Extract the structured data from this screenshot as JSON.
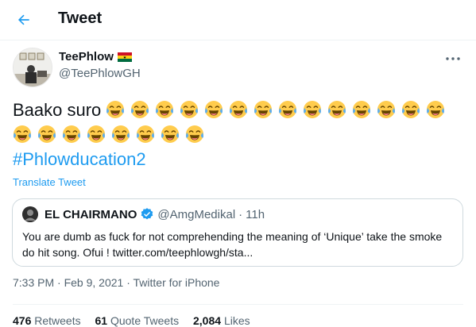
{
  "header": {
    "title": "Tweet",
    "back_icon": "arrow-left-icon",
    "accent": "#1d9bf0"
  },
  "author": {
    "name": "TeePhlow",
    "flag": "Ghana flag",
    "handle": "@TeePhlowGH"
  },
  "tweet": {
    "text": "Baako suro",
    "emoji": "face-with-tears-of-joy",
    "emoji_count_line1": 17,
    "emoji_count_line2": 8,
    "hashtag": "#Phlowducation2",
    "translate_label": "Translate Tweet"
  },
  "quoted": {
    "name": "EL CHAIRMANO",
    "verified": true,
    "handle": "@AmgMedikal",
    "separator": "·",
    "time": "11h",
    "text": "You are dumb as fuck for not comprehending the meaning of ‘Unique’ take the smoke do hit song. Ofui ! twitter.com/teephlowgh/sta..."
  },
  "meta": {
    "time": "7:33 PM",
    "date": "Feb 9, 2021",
    "source": "Twitter for iPhone",
    "separator": "·"
  },
  "stats": {
    "retweets_count": "476",
    "retweets_label": "Retweets",
    "quotes_count": "61",
    "quotes_label": "Quote Tweets",
    "likes_count": "2,084",
    "likes_label": "Likes"
  }
}
